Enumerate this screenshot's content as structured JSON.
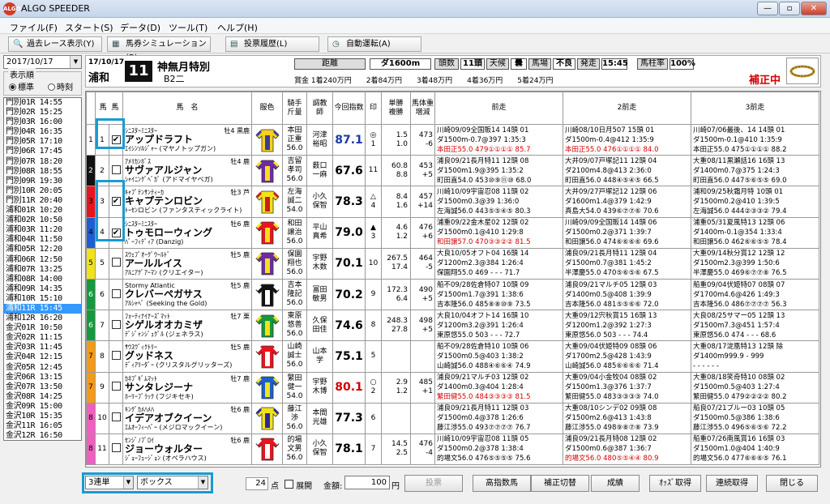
{
  "window": {
    "title": "ALGO SPEEDER",
    "icon_text": "ALGO",
    "controls": [
      "—",
      "▫",
      "✕"
    ]
  },
  "menu": [
    "ファイル(F)",
    "スタート(S)",
    "データ(D)",
    "ツール(T)",
    "ヘルプ(H)"
  ],
  "toolbar": [
    "過去レース表示(Y)",
    "馬券シミュレーション(B)",
    "投票履歴(L)",
    "自動運転(A)"
  ],
  "left": {
    "date": "2017/10/17",
    "order_label": "表示順",
    "order_options": [
      "標準",
      "時刻"
    ],
    "races": [
      "門別01R 14:55",
      "門別02R 15:25",
      "門別03R 16:00",
      "門別04R 16:35",
      "門別05R 17:10",
      "門別06R 17:45",
      "門別07R 18:20",
      "門別08R 18:55",
      "門別09R 19:30",
      "門別10R 20:05",
      "門別11R 20:40",
      "浦和01R 10:20",
      "浦和02R 10:50",
      "浦和03R 11:20",
      "浦和04R 11:50",
      "浦和05R 12:20",
      "浦和06R 12:50",
      "浦和07R 13:25",
      "浦和08R 14:00",
      "浦和09R 14:35",
      "浦和10R 15:10",
      "浦和11R 15:45",
      "浦和12R 16:20",
      "金沢01R 10:50",
      "金沢02R 11:15",
      "金沢03R 11:45",
      "金沢04R 12:15",
      "金沢05R 12:45",
      "金沢06R 13:15",
      "金沢07R 13:50",
      "金沢08R 14:25",
      "金沢09R 15:00",
      "金沢10R 15:35",
      "金沢11R 16:05",
      "金沢12R 16:50"
    ]
  },
  "header": {
    "date": "17/10/17",
    "track": "浦和",
    "race_no": "11",
    "race_name": "神無月特別",
    "race_class": "B2二",
    "labels": {
      "dist": "距離",
      "count": "頭数",
      "weather": "天候",
      "baba": "馬場",
      "start": "発走",
      "rate": "馬柱率"
    },
    "dist": "ダ1600m",
    "count": "11頭",
    "weather": "曇",
    "baba": "不良",
    "start": "15:45",
    "rate": "100%",
    "prizes": "賞金 1着240万円　　2着84万円　　3着48万円　　4着36万円　　5着24万円",
    "hosei": "補正中"
  },
  "columns": [
    "枠",
    "馬",
    "馬　名",
    "",
    "騎手\n斤量",
    "調教\n師",
    "今回指数",
    "印",
    "単勝\n複勝",
    "馬体重\n増減",
    "前走",
    "2前走",
    "3前走"
  ],
  "horses": [
    {
      "waku": "1",
      "no": "1",
      "checked": true,
      "sire": "ｼﾆｽﾀｰﾐﾆｽﾀｰ",
      "sexage": "牡4 黒鹿",
      "name": "アップドラフト",
      "dam": "ｴｲｼﾝｿﾙｼﾞｬｰ (マヤノトップガン)",
      "jockey": [
        "本田",
        "正重",
        "56.0"
      ],
      "trainer": [
        "河津",
        "裕昭"
      ],
      "score": "87.1",
      "score_color": "blu",
      "mark": "◎",
      "pop": "1",
      "win": "1.5",
      "place": "1.0",
      "wt": "473",
      "wtd": "-6",
      "p1": [
        "川崎09/09全国販14 14頭 01",
        "ダ1500m-0.7@397 1:35:3",
        "本田正55.0 479①①①① 85.7"
      ],
      "p1c": "red",
      "p2": [
        "川崎08/10日月507 15頭 01",
        "ダ1500m-0.4@412 1:35:9",
        "本田正55.0 476①①①① 84.0"
      ],
      "p2c": "red",
      "p3": [
        "川崎07/06最後、14 14頭 01",
        "ダ1500m-0.1@410 1:35:9",
        "本田正55.0 475①①①① 88.2"
      ],
      "p3c": "blu",
      "fs": "＜"
    },
    {
      "waku": "2",
      "no": "2",
      "checked": false,
      "sire": "ｱﾒﾘｶﾝﾎﾞｽ",
      "sexage": "牡4 鹿",
      "name": "サヴァアルジャン",
      "dam": "ｼｬｲﾆﾝｸﾞﾍﾞｶﾞ (アドマイヤベガ)",
      "jockey": [
        "吉留",
        "孝司",
        "56.0"
      ],
      "trainer": [
        "薮口",
        "一麻"
      ],
      "score": "67.6",
      "score_color": "",
      "mark": "",
      "pop": "11",
      "win": "60.8",
      "place": "8.8",
      "wt": "453",
      "wtd": "+5",
      "p1": [
        "浦良09/21長月特11 12頭 08",
        "ダ1500m1.9@395 1:35:2",
        "町田直54.0 453⑩⑨⑪⑩ 68.0"
      ],
      "p1c": "",
      "p2": [
        "大井09/07戸塚記11 12頭 04",
        "ダ2100m4.8@413 2:36:0",
        "町田直56.0 448④⑤④⑤ 66.5"
      ],
      "p2c": "",
      "p3": [
        "大重08/11黒瀬話16 16頭 13",
        "ダ1400m0.7@375 1:24:3",
        "町田直56.0 447⑤⑥⑤⑤ 69.0"
      ],
      "p3c": "",
      "fs": ""
    },
    {
      "waku": "3",
      "no": "3",
      "checked": true,
      "sire": "ｷｬﾌﾟﾃﾝｻﾝﾃｨｰｶ",
      "sexage": "牡3 芦",
      "name": "キャプテンロビン",
      "dam": "ﾄｰｾﾝロビン (ファンタスティックライト)",
      "jockey": [
        "左海",
        "誠二",
        "54.0"
      ],
      "trainer": [
        "小久",
        "保智"
      ],
      "score": "78.3",
      "score_color": "",
      "mark": "△",
      "pop": "4",
      "win": "8.4",
      "place": "1.6",
      "wt": "457",
      "wtd": "+14",
      "p1": [
        "川崎10/09宇宙忍08 11頭 02",
        "ダ1500m0.3@39 1:36:0",
        "左海誠56.0 443⑤⑤④⑤ 80.3"
      ],
      "p1c": "",
      "p2": [
        "大井09/27戸塚記12 12頭 06",
        "ダ1600m1.4@379 1:42:9",
        "真島大54.0 439⑥⑦⑦⑥ 70.6"
      ],
      "p2c": "",
      "p3": [
        "浦和09/25秋霜月特 10頭 01",
        "ダ1500m0.2@410 1:39:5",
        "左海誠56.0 444②③③② 79.4"
      ],
      "p3c": "",
      "fs": ""
    },
    {
      "waku": "4",
      "no": "4",
      "checked": true,
      "sire": "ｼﾆｽﾀｰﾐﾆｽﾀｰ",
      "sexage": "牡6 鹿",
      "name": "トゥモローウィング",
      "dam": "ﾊﾞｰﾌｨﾃﾞｨｱ (Danzig)",
      "jockey": [
        "和田",
        "譲治",
        "56.0"
      ],
      "trainer": [
        "平山",
        "真希"
      ],
      "score": "79.0",
      "score_color": "",
      "mark": "▲",
      "pop": "3",
      "win": "4.6",
      "place": "1.2",
      "wt": "476",
      "wtd": "+6",
      "p1": [
        "浦重09/22金木星02 12頭 02",
        "ダ1500m0.1@410 1:29:8",
        "和田譲57.0 470③③②② 81.5"
      ],
      "p1c": "red",
      "p2": [
        "川崎09/09全国販14 14頭 06",
        "ダ1500m0.2@371 1:39:7",
        "和田譲56.0 474⑥⑥⑥⑥ 69.6"
      ],
      "p2c": "",
      "p3": [
        "浦重05/31夏風特13 12頭 06",
        "ダ1400m-0.1@354 1:33:4",
        "和田譲56.0 462⑥⑥⑤⑤ 78.4"
      ],
      "p3c": "",
      "fs": ""
    },
    {
      "waku": "5",
      "no": "5",
      "checked": false,
      "sire": "ｽｳｪﾌﾞｵｰｸﾞｳｰﾙﾄﾞ",
      "sexage": "牡5 鹿",
      "name": "アールルイス",
      "dam": "ｱﾙﾆｱｸﾞｱｰﾏﾝ (クリエイター)",
      "jockey": [
        "保園",
        "翔也",
        "56.0"
      ],
      "trainer": [
        "宇野",
        "木数"
      ],
      "score": "70.1",
      "score_color": "",
      "mark": "",
      "pop": "10",
      "win": "267.5",
      "place": "17.4",
      "wt": "464",
      "wtd": "-5",
      "p1": [
        "大良10/05オフト04 16頭 14",
        "ダ1200m2.3@384 1:26:4",
        "保園翔55.0 469 - - - 71.7"
      ],
      "p1c": "",
      "p2": [
        "浦良09/21長月特11 12頭 04",
        "ダ1500m0.7@381 1:45:2",
        "半澤慶55.0 470⑤⑥⑤⑥ 67.5"
      ],
      "p2c": "",
      "p3": [
        "大重09/14秋分賞12 12頭 12",
        "ダ1500m2.3@399 1:50:6",
        "半澤慶55.0 469⑥⑦⑦⑧ 76.5"
      ],
      "p3c": "",
      "fs": ""
    },
    {
      "waku": "6",
      "no": "6",
      "checked": false,
      "sire": "Stormy Atlantic",
      "sexage": "牡5 鹿",
      "name": "クレバーペガサス",
      "dam": "ｱﾙｼｬﾍﾞ (Seeking the Gold)",
      "jockey": [
        "吉本",
        "隆記",
        "56.0"
      ],
      "trainer": [
        "冨田",
        "敏男"
      ],
      "score": "70.2",
      "score_color": "",
      "mark": "",
      "pop": "9",
      "win": "172.3",
      "place": "6.4",
      "wt": "490",
      "wtd": "+5",
      "p1": [
        "船不09/28佐倉特07 10頭 09",
        "ダ1500m1.7@391 1:38:6",
        "吉本隆56.0 485⑧⑧⑩⑨ 73.5"
      ],
      "p1c": "",
      "p2": [
        "浦良09/21マルチ05 12頭 03",
        "ダ1400m0.5@408 1:39:9",
        "吉本隆56.0 481⑤⑤⑥⑥ 72.0"
      ],
      "p2c": "",
      "p3": [
        "船重09/04伏姫特07 08頭 07",
        "ダ1700m4.6@426 1:49:3",
        "吉本隆56.0 486⑦⑦⑦⑦ 56.3"
      ],
      "p3c": "",
      "fs": ""
    },
    {
      "waku": "6",
      "no": "7",
      "checked": false,
      "sire": "ﾌｫｰﾃｨﾅｲﾅｰｽﾞﾏｯﾄ",
      "sexage": "牡7 栗",
      "name": "シゲルオオカミザ",
      "dam": "ﾃﾞｼﾞｬﾝｼﾞｭｸﾞﾙ (ジェネラス)",
      "jockey": [
        "東原",
        "悠善",
        "56.0"
      ],
      "trainer": [
        "久保",
        "田佳"
      ],
      "score": "74.6",
      "score_color": "",
      "mark": "",
      "pop": "8",
      "win": "248.3",
      "place": "27.8",
      "wt": "498",
      "wtd": "+5",
      "p1": [
        "大良10/04オフト14 16頭 10",
        "ダ1200m3.2@391 1:26:4",
        "東原悠55.0 503 - - - 72.7"
      ],
      "p1c": "",
      "p2": [
        "大重09/12宍秋賞15 16頭 13",
        "ダ1200m1.2@392 1:27:3",
        "東原悠56.0 503 - - - 74.4"
      ],
      "p2c": "",
      "p3": [
        "大良08/25サマー05 12頭 13",
        "ダ1500m7.3@451 1:57:4",
        "東原悠56.0 474 - - - 68.6"
      ],
      "p3c": "",
      "fs": ""
    },
    {
      "waku": "7",
      "no": "8",
      "checked": false,
      "sire": "ｻｳｽｳﾞｨｸﾄﾘｰ",
      "sexage": "牡5 鹿",
      "name": "グッドネス",
      "dam": "ﾃﾞｨｱﾘｰﾀﾞｰ (クリスタルグリッターズ)",
      "jockey": [
        "山崎",
        "誠士",
        "56.0"
      ],
      "trainer": [
        "山本",
        "学"
      ],
      "score": "75.1",
      "score_color": "",
      "mark": "",
      "pop": "5",
      "win": "",
      "place": "",
      "wt": "",
      "wtd": "",
      "p1": [
        "船不09/28佐倉特10 10頭 06",
        "ダ1500m0.5@403 1:38:2",
        "山崎誠56.0 488④⑥⑥④ 74.9"
      ],
      "p1c": "",
      "p2": [
        "大重09/04伏姫特09 08頭 06",
        "ダ1700m2.5@428 1:43:9",
        "山崎誠56.0 485⑥⑥⑥⑥ 71.4"
      ],
      "p2c": "",
      "p3": [
        "大重08/17淀凰特13 12頭 除",
        "ダ1400m999.9 - 999",
        "- - - - - -"
      ],
      "p3c": "",
      "fs": ""
    },
    {
      "waku": "7",
      "no": "9",
      "checked": false,
      "sire": "ｶﾈﾌﾞｷﾞﾑﾏｯﾄ",
      "sexage": "牡7 鹿",
      "name": "サンタレジーナ",
      "dam": "ﾎｰﾘｰﾌﾞﾗｯｸ (フジキセキ)",
      "jockey": [
        "繁田",
        "健一",
        "54.0"
      ],
      "trainer": [
        "宇野",
        "木博"
      ],
      "score": "80.1",
      "score_color": "hi",
      "mark": "○",
      "pop": "2",
      "win": "2.9",
      "place": "1.2",
      "wt": "485",
      "wtd": "+1",
      "p1": [
        "浦良09/21マルチ03 12頭 02",
        "ダ1400m0.3@404 1:28:4",
        "繁田健55.0 484③③③③ 81.5"
      ],
      "p1c": "red",
      "p2": [
        "大重09/04小金牧04 08頭 02",
        "ダ1500m1.3@376 1:37:7",
        "繁田健55.0 483③③③③ 74.0"
      ],
      "p2c": "",
      "p3": [
        "大重08/18笑奇特10 08頭 02",
        "ダ1500m0.5@403 1:27:4",
        "繁田健55.0 479②②②② 80.2"
      ],
      "p3c": "",
      "fs": ""
    },
    {
      "waku": "8",
      "no": "10",
      "checked": false,
      "sire": "ｷﾝｸﾞｶﾒﾊﾒﾊ",
      "sexage": "牡6 鹿",
      "name": "イデアオブクイーン",
      "dam": "ｴﾑｵｰﾌｨｰﾊﾞｰ (メジロマックイーン)",
      "jockey": [
        "藤江",
        "渉",
        "56.0"
      ],
      "trainer": [
        "本間",
        "光雄"
      ],
      "score": "77.3",
      "score_color": "",
      "mark": "",
      "pop": "6",
      "win": "",
      "place": "",
      "wt": "",
      "wtd": "",
      "p1": [
        "浦良09/21長月特11 12頭 03",
        "ダ1500m0.4@378 1:26:6",
        "藤江渉55.0 493⑦⑦⑦⑦ 76.7"
      ],
      "p1c": "",
      "p2": [
        "大重08/10シンデ02 09頭 08",
        "ダ1500m2.6@413 1:43:8",
        "藤江渉55.0 498⑨⑧⑦⑧ 73.9"
      ],
      "p2c": "",
      "p3": [
        "船良07/21ブルー03 10頭 05",
        "ダ1500m0.5@386 1:38:6",
        "藤江渉55.0 496⑤⑥⑤⑥ 72.2"
      ],
      "p3c": "",
      "fs": ""
    },
    {
      "waku": "8",
      "no": "11",
      "checked": false,
      "sire": "ｾﾝｼﾞﾉﾌﾞﾛｲ",
      "sexage": "牡6 鹿",
      "name": "ジョーウォルター",
      "dam": "ｼﾞｮｰﾌｭｰｼﾞｮﾝ (オペラハウス)",
      "jockey": [
        "的場",
        "文男",
        "56.0"
      ],
      "trainer": [
        "小久",
        "保智"
      ],
      "score": "78.1",
      "score_color": "",
      "mark": "",
      "pop": "7",
      "win": "14.5",
      "place": "2.5",
      "wt": "476",
      "wtd": "-4",
      "p1": [
        "川崎10/09宇宙忍08 11頭 05",
        "ダ1500m0.2@378 1:38:4",
        "的場文56.0 476⑤⑤⑤⑤ 75.6"
      ],
      "p1c": "",
      "p2": [
        "浦良09/21長月特08 12頭 02",
        "ダ1500m0.6@387 1:36:7",
        "的場文56.0 480⑤⑤④④ 80.9"
      ],
      "p2c": "red",
      "p3": [
        "船重07/26南風賞16 16頭 03",
        "ダ1500m1.0@404 1:40:9",
        "的場文56.0 477⑥⑥⑥⑤ 76.1"
      ],
      "p3c": "",
      "fs": ""
    }
  ],
  "bottom": {
    "bet_type": "3連単",
    "bet_method": "ボックス",
    "points": "24",
    "points_unit": "点",
    "tenkai": "展開",
    "amount_label": "金額:",
    "amount": "100",
    "yen": "円",
    "vote": "投票",
    "buttons": [
      "高指数馬",
      "補正切替",
      "成績",
      "ｵｯｽﾞ取得",
      "連続取得",
      "閉じる"
    ]
  },
  "colors": {
    "waku": [
      "#ffffff",
      "#111111",
      "#e8141e",
      "#1a5fd1",
      "#f2e21a",
      "#16993d",
      "#f39a1b",
      "#ee5fc0"
    ],
    "highlight": "#1b9ad1",
    "accent_red": "#d40000",
    "score_blue": "#1a3aa8"
  }
}
